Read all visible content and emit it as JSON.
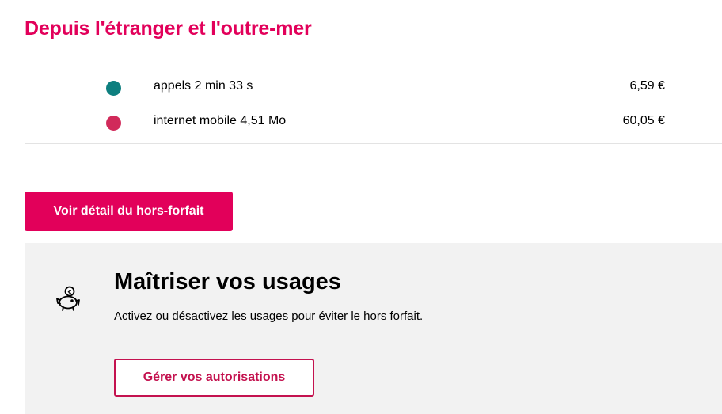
{
  "section": {
    "title": "Depuis l'étranger et l'outre-mer"
  },
  "usages": [
    {
      "label": "appels 2 min 33 s",
      "amount": "6,59 €",
      "color": "#0e7f7f"
    },
    {
      "label": "internet mobile 4,51 Mo",
      "amount": "60,05 €",
      "color": "#d12a5a"
    }
  ],
  "actions": {
    "detail_label": "Voir détail du hors-forfait"
  },
  "card": {
    "icon": "piggy-bank-euro-icon",
    "title": "Maîtriser vos usages",
    "text": "Activez ou désactivez les usages pour éviter le hors forfait.",
    "button_label": "Gérer vos autorisations"
  },
  "colors": {
    "accent": "#e2005a",
    "secondary_accent": "#c4124f",
    "card_bg": "#f2f2f2"
  }
}
